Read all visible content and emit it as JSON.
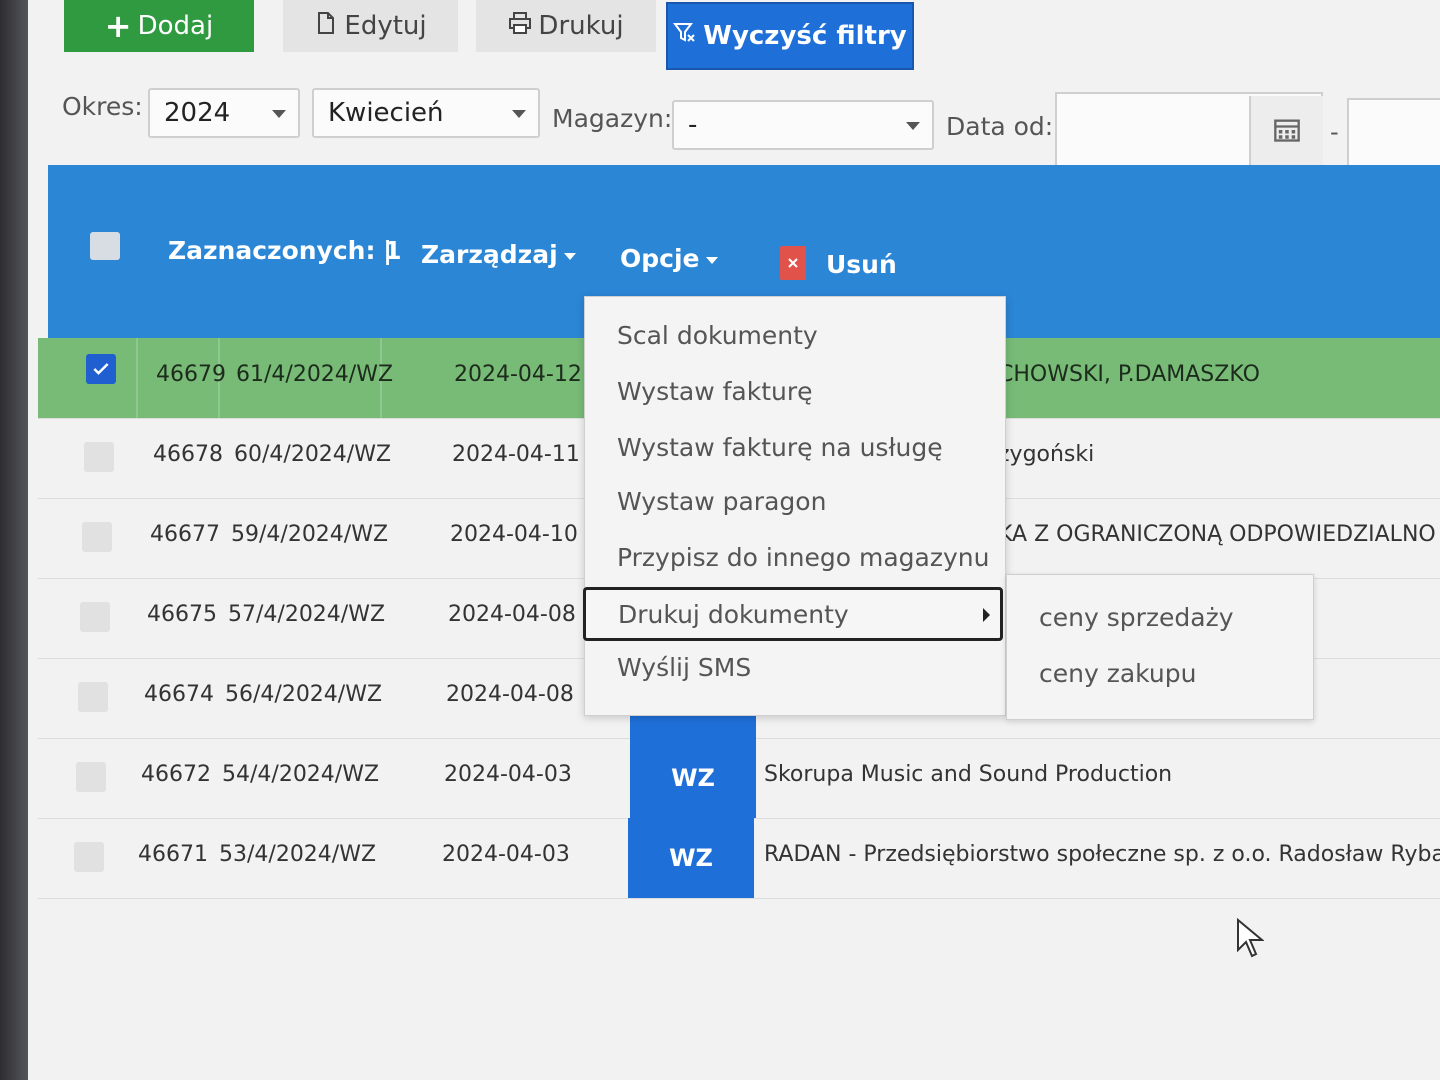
{
  "toolbar": {
    "add_label": "Dodaj",
    "edit_label": "Edytuj",
    "print_label": "Drukuj",
    "clear_filters_label": "Wyczyść filtry"
  },
  "filters": {
    "period_label": "Okres:",
    "year_value": "2024",
    "month_value": "Kwiecień",
    "warehouse_label": "Magazyn:",
    "warehouse_value": "-",
    "date_from_label": "Data od:",
    "date_separator": "-"
  },
  "bulk_bar": {
    "selected_text": "Zaznaczonych: 1",
    "separator": "|",
    "manage_label": "Zarządzaj",
    "options_label": "Opcje",
    "delete_label": "Usuń"
  },
  "rows": [
    {
      "id": "46679",
      "number": "61/4/2024/WZ",
      "date": "2024-04-12",
      "type": "",
      "client": "CHOWSKI, P.DAMASZKO",
      "checked": true
    },
    {
      "id": "46678",
      "number": "60/4/2024/WZ",
      "date": "2024-04-11",
      "type": "",
      "client": "zygoński",
      "checked": false
    },
    {
      "id": "46677",
      "number": "59/4/2024/WZ",
      "date": "2024-04-10",
      "type": "",
      "client": "KA Z OGRANICZONĄ ODPOWIEDZIALNO",
      "checked": false
    },
    {
      "id": "46675",
      "number": "57/4/2024/WZ",
      "date": "2024-04-08",
      "type": "",
      "client": "",
      "checked": false
    },
    {
      "id": "46674",
      "number": "56/4/2024/WZ",
      "date": "2024-04-08",
      "type": "",
      "client": "",
      "checked": false
    },
    {
      "id": "46672",
      "number": "54/4/2024/WZ",
      "date": "2024-04-03",
      "type": "WZ",
      "client": "Skorupa Music and Sound Production",
      "checked": false
    },
    {
      "id": "46671",
      "number": "53/4/2024/WZ",
      "date": "2024-04-03",
      "type": "WZ",
      "client": "RADAN - Przedsiębiorstwo społeczne sp. z o.o. Radosław Rybars",
      "checked": false
    }
  ],
  "options_menu": {
    "items": [
      "Scal dokumenty",
      "Wystaw fakturę",
      "Wystaw fakturę na usługę",
      "Wystaw paragon",
      "Przypisz do innego magazynu",
      "Drukuj dokumenty",
      "Wyślij SMS"
    ],
    "submenu": [
      "ceny sprzedaży",
      "ceny zakupu"
    ]
  },
  "colors": {
    "header_blue": "#2b86d6",
    "button_blue": "#1f6fd9",
    "add_green": "#2f9a3f",
    "selected_row_green": "#77bb77"
  }
}
